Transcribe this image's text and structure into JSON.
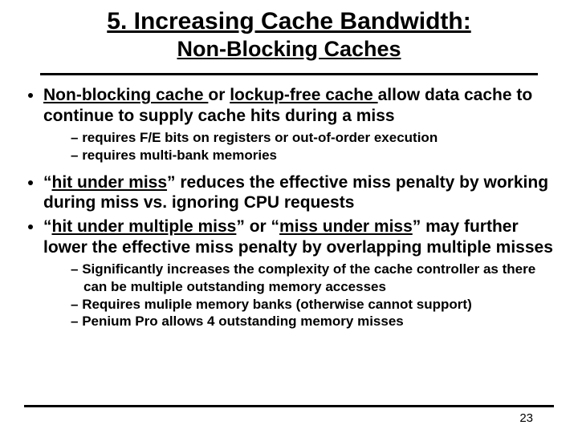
{
  "title": {
    "line1": "5. Increasing Cache Bandwidth:",
    "line2": "Non-Blocking Caches"
  },
  "bullets": [
    {
      "parts": [
        {
          "text": "Non-blocking cache ",
          "underline": true
        },
        {
          "text": "or  "
        },
        {
          "text": "lockup-free cache ",
          "underline": true
        },
        {
          "text": "allow data cache to continue to supply cache hits during a miss"
        }
      ],
      "sub": [
        "requires F/E bits on registers or out-of-order execution",
        "requires multi-bank memories"
      ]
    },
    {
      "parts": [
        {
          "text": "“"
        },
        {
          "text": "hit under miss",
          "underline": true
        },
        {
          "text": "”  reduces the effective miss penalty by working during miss vs. ignoring CPU requests"
        }
      ]
    },
    {
      "parts": [
        {
          "text": "“"
        },
        {
          "text": "hit under multiple miss",
          "underline": true
        },
        {
          "text": "” or “"
        },
        {
          "text": "miss under miss",
          "underline": true
        },
        {
          "text": "”  may further lower the effective miss penalty by overlapping multiple misses"
        }
      ],
      "sub": [
        "Significantly increases the complexity of the cache controller as there can be multiple outstanding memory accesses",
        "Requires muliple memory banks (otherwise cannot support)",
        "Penium Pro allows 4 outstanding memory misses"
      ]
    }
  ],
  "page_number": "23"
}
